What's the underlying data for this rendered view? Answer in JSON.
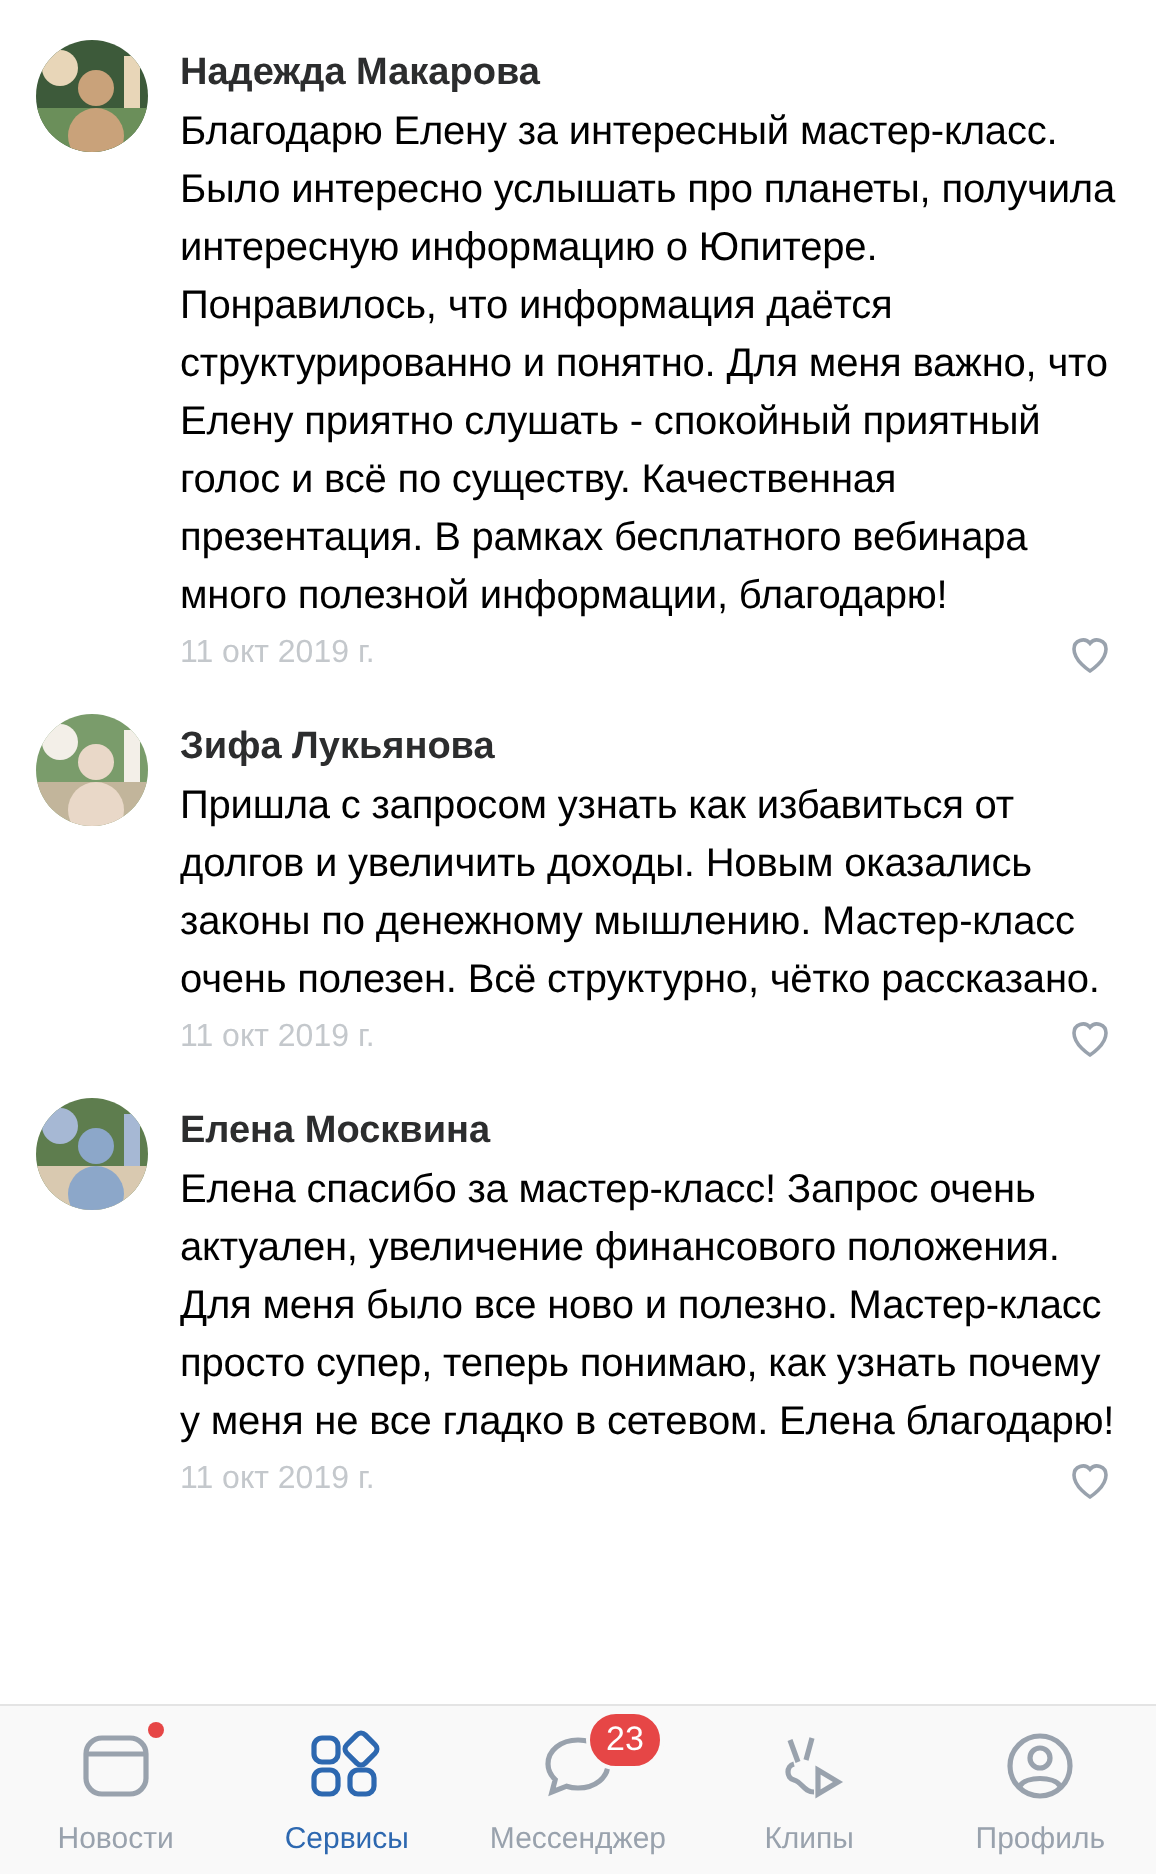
{
  "comments": [
    {
      "author": "Надежда Макарова",
      "text": "Благодарю Елену за интересный мастер-класс. Было интересно услышать про планеты, получила интересную информацию о Юпитере. Понравилось, что информация даётся структурированно и понятно. Для меня важно, что Елену приятно слушать - спокойный приятный голос и всё по существу. Качественная презентация. В рамках бесплатного вебинара много полезной информации, благодарю!",
      "date": "11 окт 2019 г.",
      "liked": false
    },
    {
      "author": "Зифа Лукьянова",
      "text": "Пришла с запросом узнать как избавиться от долгов и увеличить доходы. Новым оказались законы по денежному мышлению. Мастер-класс очень полезен. Всё структурно, чётко рассказано.",
      "date": "11 окт 2019 г.",
      "liked": false
    },
    {
      "author": "Елена Москвина",
      "text": "Елена спасибо за мастер-класс! Запрос очень актуален, увеличение финансового положения. Для меня было все ново и полезно. Мастер-класс просто супер, теперь понимаю, как узнать почему у меня не все гладко в сетевом. Елена благодарю!",
      "date": "11 окт 2019 г.",
      "liked": false
    }
  ],
  "tab_bar": [
    {
      "kind": "news",
      "label": "Новости",
      "selected": false,
      "dot": true
    },
    {
      "kind": "services",
      "label": "Сервисы",
      "selected": true,
      "dot": false
    },
    {
      "kind": "messenger",
      "label": "Мессенджер",
      "selected": false,
      "dot": false,
      "badge": "23"
    },
    {
      "kind": "clips",
      "label": "Клипы",
      "selected": false,
      "dot": false
    },
    {
      "kind": "profile",
      "label": "Профиль",
      "selected": false,
      "dot": false
    }
  ]
}
